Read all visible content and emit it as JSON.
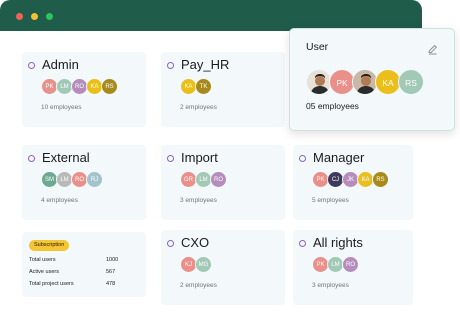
{
  "window": {
    "dots": [
      {
        "name": "close-dot",
        "color": "#f0635c"
      },
      {
        "name": "minimize-dot",
        "color": "#f5bf2e"
      },
      {
        "name": "maximize-dot",
        "color": "#32c15c"
      }
    ]
  },
  "groups": [
    {
      "id": "admin",
      "title": "Admin",
      "count": "10 employees",
      "avatars": [
        {
          "i": "PK",
          "c": "#e9908a"
        },
        {
          "i": "LM",
          "c": "#a2c9b5"
        },
        {
          "i": "RO",
          "c": "#b68cbd"
        },
        {
          "i": "KA",
          "c": "#eabf1c"
        },
        {
          "i": "RS",
          "c": "#a88a1c"
        }
      ]
    },
    {
      "id": "payhr",
      "title": "Pay_HR",
      "count": "2 employees",
      "avatars": [
        {
          "i": "KA",
          "c": "#eabf1c"
        },
        {
          "i": "TK",
          "c": "#a88a1c"
        }
      ]
    },
    {
      "id": "external",
      "title": "External",
      "count": "4 employees",
      "avatars": [
        {
          "i": "SM",
          "c": "#6da890"
        },
        {
          "i": "LM",
          "c": "#b9b9b9"
        },
        {
          "i": "RO",
          "c": "#e9908a"
        },
        {
          "i": "RJ",
          "c": "#a3c4cc"
        }
      ]
    },
    {
      "id": "import",
      "title": "Import",
      "count": "3 employees",
      "avatars": [
        {
          "i": "GR",
          "c": "#e9908a"
        },
        {
          "i": "LM",
          "c": "#a2c9b5"
        },
        {
          "i": "RO",
          "c": "#b68cbd"
        }
      ]
    },
    {
      "id": "manager",
      "title": "Manager",
      "count": "5 employees",
      "avatars": [
        {
          "i": "PK",
          "c": "#e9908a"
        },
        {
          "i": "CJ",
          "c": "#3e3a5c"
        },
        {
          "i": "JK",
          "c": "#b68cbd"
        },
        {
          "i": "KA",
          "c": "#eabf1c"
        },
        {
          "i": "RS",
          "c": "#a88a1c"
        }
      ]
    },
    {
      "id": "cxo",
      "title": "CXO",
      "count": "2 employees",
      "avatars": [
        {
          "i": "KJ",
          "c": "#e9908a"
        },
        {
          "i": "MG",
          "c": "#a2c9b5"
        }
      ]
    },
    {
      "id": "allrights",
      "title": "All rights",
      "count": "3 employees",
      "avatars": [
        {
          "i": "PK",
          "c": "#e9908a"
        },
        {
          "i": "LM",
          "c": "#a2c9b5"
        },
        {
          "i": "RO",
          "c": "#b68cbd"
        }
      ]
    }
  ],
  "user_popup": {
    "title": "User",
    "count": "05 employees",
    "avatars": [
      {
        "i": "",
        "c": "#e8e1d7",
        "photo": true
      },
      {
        "i": "PK",
        "c": "#e9908a"
      },
      {
        "i": "",
        "c": "#c9b8a6",
        "photo": true
      },
      {
        "i": "KA",
        "c": "#eabf1c"
      },
      {
        "i": "RS",
        "c": "#a2c9b5"
      }
    ]
  },
  "subscription": {
    "badge": "Subscription",
    "rows": [
      {
        "label": "Total users",
        "value": "1000"
      },
      {
        "label": "Active users",
        "value": "567"
      },
      {
        "label": "Total project users",
        "value": "478"
      }
    ]
  }
}
